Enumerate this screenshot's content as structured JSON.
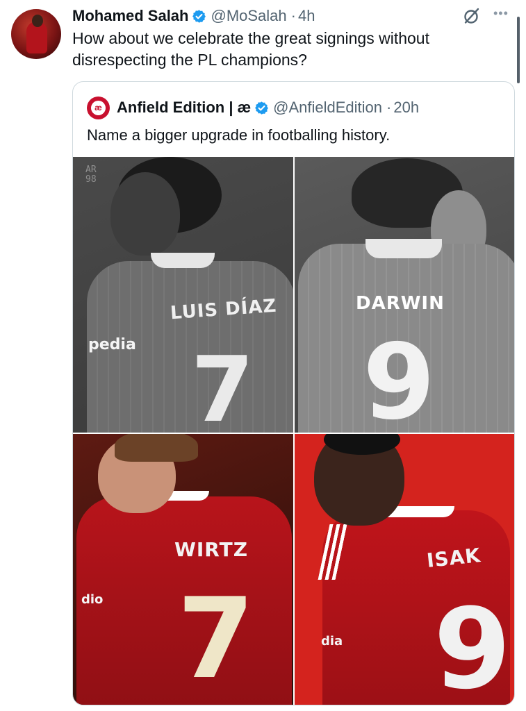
{
  "tweet": {
    "display_name": "Mohamed Salah",
    "handle": "@MoSalah",
    "separator": "·",
    "time": "4h",
    "text": "How about we celebrate the great signings without disrespecting the PL champions?",
    "verified_color": "#1d9bf0"
  },
  "quote": {
    "display_name": "Anfield Edition | æ",
    "avatar_text": "æ",
    "handle": "@AnfieldEdition",
    "separator": "·",
    "time": "20h",
    "text": "Name a bigger upgrade in footballing history."
  },
  "media": {
    "watermark": "AR 98",
    "panels": [
      {
        "shirt_name": "LUIS DÍAZ",
        "number": "7",
        "sponsor": "pedia"
      },
      {
        "shirt_name": "DARWIN",
        "number": "9",
        "sponsor": ""
      },
      {
        "shirt_name": "WIRTZ",
        "number": "7",
        "sponsor": "dio"
      },
      {
        "shirt_name": "ISAK",
        "number": "9",
        "sponsor": "dia"
      }
    ]
  },
  "icons": {
    "grok": "grok-icon",
    "more": "more-icon"
  },
  "colors": {
    "accent": "#1d9bf0",
    "text_secondary": "#536471",
    "liverpool_red": "#c8102e"
  }
}
